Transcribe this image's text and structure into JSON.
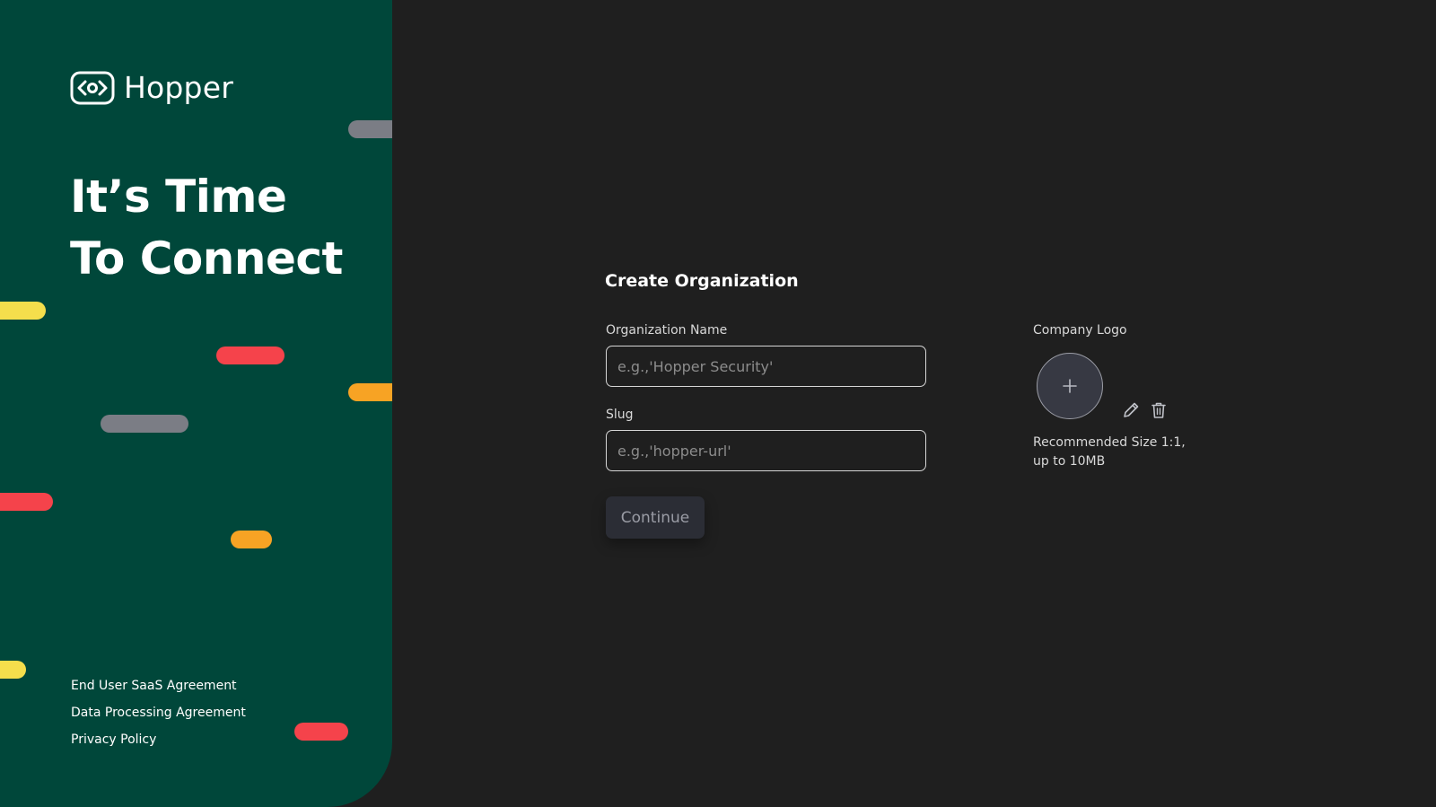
{
  "brand": {
    "name": "Hopper"
  },
  "hero": {
    "line1": "It’s Time",
    "line2": "To Connect"
  },
  "footer": {
    "links": [
      "End User SaaS Agreement",
      "Data Processing Agreement",
      "Privacy Policy"
    ]
  },
  "form": {
    "title": "Create Organization",
    "org_name": {
      "label": "Organization Name",
      "placeholder": "e.g.,'Hopper Security'",
      "value": ""
    },
    "slug": {
      "label": "Slug",
      "placeholder": "e.g.,'hopper-url'",
      "value": ""
    },
    "continue_label": "Continue"
  },
  "logo_upload": {
    "label": "Company Logo",
    "add_icon": "plus-icon",
    "edit_icon": "pencil-icon",
    "delete_icon": "trash-icon",
    "hint": "Recommended Size 1:1, up to 10MB"
  },
  "colors": {
    "panel_green": "#00473a",
    "background": "#1f1f1f",
    "pill_yellow": "#f5de4c",
    "pill_red": "#f5434b",
    "pill_orange": "#f7a324",
    "pill_gray": "#7b7d85",
    "button_bg": "#2b2d35"
  }
}
